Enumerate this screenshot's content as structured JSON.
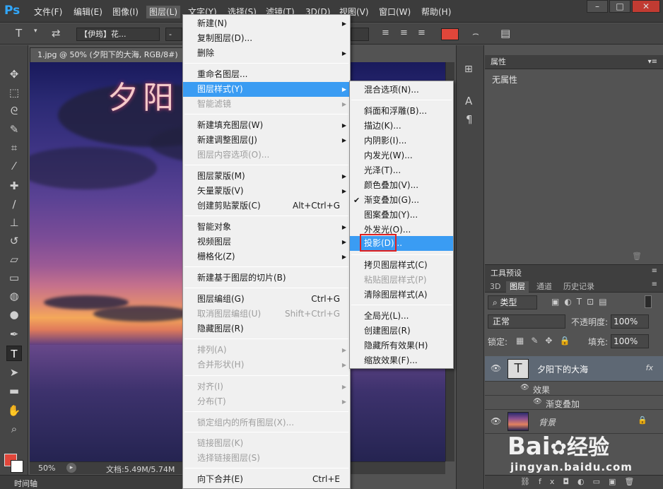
{
  "menubar": {
    "items": [
      "文件(F)",
      "编辑(E)",
      "图像(I)",
      "图层(L)",
      "文字(Y)",
      "选择(S)",
      "滤镜(T)",
      "3D(D)",
      "视图(V)",
      "窗口(W)",
      "帮助(H)"
    ],
    "app_logo": "Ps"
  },
  "options_bar": {
    "font_family": "【伊筠】花...",
    "font_style": "-"
  },
  "document": {
    "tab_title": "1.jpg @ 50% (夕阳下的大海, RGB/8#)",
    "canvas_text": "夕阳",
    "zoom": "50%",
    "doc_info": "文档:5.49M/5.74M",
    "timeline_label": "时间轴"
  },
  "layer_menu": {
    "items": [
      {
        "label": "新建(N)",
        "sub": true
      },
      {
        "label": "复制图层(D)..."
      },
      {
        "label": "删除",
        "sub": true
      },
      {
        "label": "重命名图层..."
      },
      {
        "label": "图层样式(Y)",
        "sub": true,
        "active": true
      },
      {
        "label": "智能滤镜",
        "sub": true,
        "disabled": true
      },
      {
        "label": "新建填充图层(W)",
        "sub": true
      },
      {
        "label": "新建调整图层(J)",
        "sub": true
      },
      {
        "label": "图层内容选项(O)...",
        "disabled": true
      },
      {
        "label": "图层蒙版(M)",
        "sub": true
      },
      {
        "label": "矢量蒙版(V)",
        "sub": true
      },
      {
        "label": "创建剪贴蒙版(C)",
        "shortcut": "Alt+Ctrl+G"
      },
      {
        "label": "智能对象",
        "sub": true
      },
      {
        "label": "视频图层",
        "sub": true
      },
      {
        "label": "栅格化(Z)",
        "sub": true
      },
      {
        "label": "新建基于图层的切片(B)"
      },
      {
        "label": "图层编组(G)",
        "shortcut": "Ctrl+G"
      },
      {
        "label": "取消图层编组(U)",
        "shortcut": "Shift+Ctrl+G",
        "disabled": true
      },
      {
        "label": "隐藏图层(R)"
      },
      {
        "label": "排列(A)",
        "sub": true,
        "disabled": true
      },
      {
        "label": "合并形状(H)",
        "sub": true,
        "disabled": true
      },
      {
        "label": "对齐(I)",
        "sub": true,
        "disabled": true
      },
      {
        "label": "分布(T)",
        "sub": true,
        "disabled": true
      },
      {
        "label": "锁定组内的所有图层(X)...",
        "disabled": true
      },
      {
        "label": "链接图层(K)",
        "disabled": true
      },
      {
        "label": "选择链接图层(S)",
        "disabled": true
      },
      {
        "label": "向下合并(E)",
        "shortcut": "Ctrl+E"
      }
    ]
  },
  "style_submenu": {
    "items": [
      {
        "label": "混合选项(N)..."
      },
      {
        "label": "斜面和浮雕(B)..."
      },
      {
        "label": "描边(K)..."
      },
      {
        "label": "内阴影(I)..."
      },
      {
        "label": "内发光(W)..."
      },
      {
        "label": "光泽(T)..."
      },
      {
        "label": "颜色叠加(V)..."
      },
      {
        "label": "渐变叠加(G)...",
        "checked": true
      },
      {
        "label": "图案叠加(Y)..."
      },
      {
        "label": "外发光(O)..."
      },
      {
        "label": "投影(D)...",
        "highlighted": true
      },
      {
        "label": "拷贝图层样式(C)"
      },
      {
        "label": "粘贴图层样式(P)",
        "disabled": true
      },
      {
        "label": "清除图层样式(A)"
      },
      {
        "label": "全局光(L)..."
      },
      {
        "label": "创建图层(R)"
      },
      {
        "label": "隐藏所有效果(H)"
      },
      {
        "label": "缩放效果(F)..."
      }
    ]
  },
  "properties_panel": {
    "title": "属性",
    "empty_text": "无属性"
  },
  "presets_panel": {
    "title": "工具预设"
  },
  "layers_panel": {
    "tabs": [
      "3D",
      "图层",
      "通道",
      "历史记录"
    ],
    "filter_type": "类型",
    "blend_mode": "正常",
    "opacity_label": "不透明度:",
    "opacity_value": "100%",
    "lock_label": "锁定:",
    "fill_label": "填充:",
    "fill_value": "100%",
    "layers": [
      {
        "name": "夕阳下的大海",
        "type": "text",
        "fx": "fx"
      },
      {
        "name": "效果"
      },
      {
        "name": "渐变叠加"
      },
      {
        "name": "背景",
        "type": "image"
      }
    ]
  },
  "watermark": {
    "brand": "Bai",
    "brand2": "经验",
    "url": "jingyan.baidu.com"
  },
  "colors": {
    "foreground": "#e0463a",
    "accent": "#3a9cf3",
    "highlight_box": "#e02020"
  }
}
